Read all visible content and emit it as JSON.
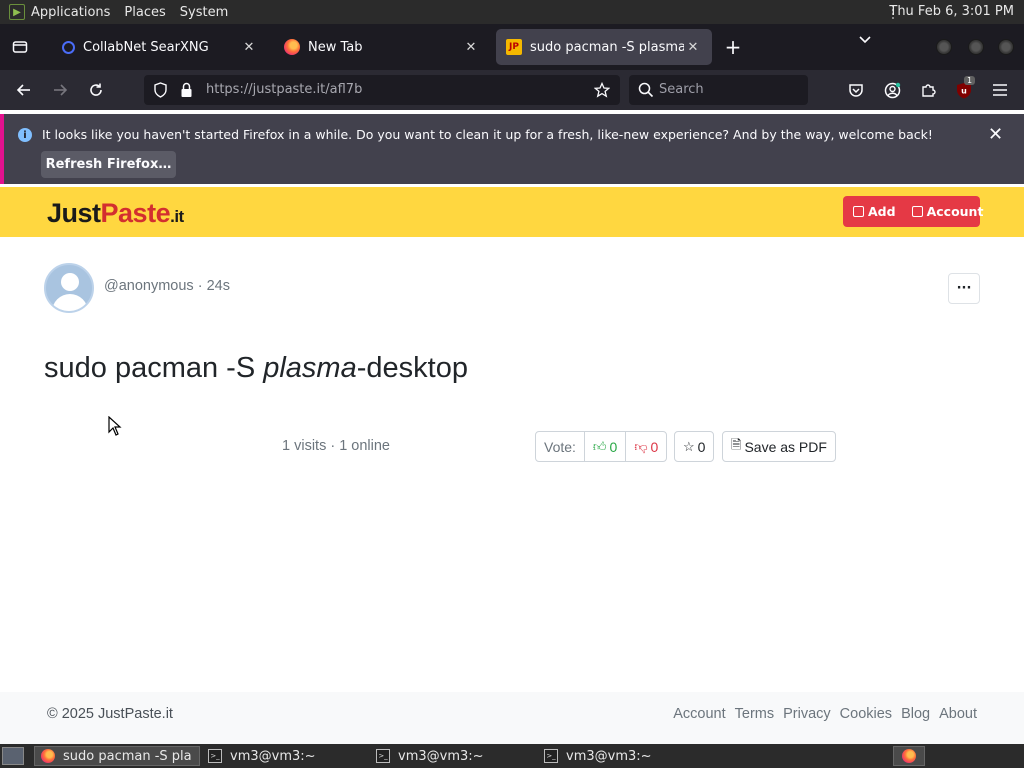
{
  "panel": {
    "menus": [
      "Applications",
      "Places",
      "System"
    ],
    "clock": "Thu Feb  6,  3:01 PM"
  },
  "tabs": [
    {
      "title": "CollabNet SearXNG",
      "icon": "search-icon",
      "selected": false
    },
    {
      "title": "New Tab",
      "icon": "firefox-icon",
      "selected": false
    },
    {
      "title": "sudo pacman -S plasma-desktop",
      "icon": "justpaste-icon",
      "selected": true,
      "visible_title": "sudo pacman -S plasma-de"
    }
  ],
  "navbar": {
    "url_host": "https://justpaste.it/",
    "url_path": "afl7b",
    "search_placeholder": "Search",
    "extension_badge": "1"
  },
  "notification": {
    "message": "It looks like you haven't started Firefox in a while. Do you want to clean it up for a fresh, like-new experience? And by the way, welcome back!",
    "button": "Refresh Firefox…"
  },
  "site": {
    "logo_just": "Just",
    "logo_paste": "Paste",
    "logo_it": ".it",
    "add_label": "Add",
    "account_label": "Account",
    "header_color": "#ffd740",
    "accent_color": "#e53945"
  },
  "paste": {
    "author": "@anonymous",
    "age": "24s",
    "title_before": "sudo pacman -S ",
    "title_italic": "plasma",
    "title_after": "-desktop",
    "stats": "1 visits · 1 online",
    "vote_label": "Vote:",
    "upvotes": "0",
    "downvotes": "0",
    "favorites": "0",
    "save_pdf": "Save as PDF"
  },
  "footer": {
    "copyright": "© 2025 JustPaste.it",
    "links": [
      "Account",
      "Terms",
      "Privacy",
      "Cookies",
      "Blog",
      "About"
    ]
  },
  "taskbar": {
    "tasks": [
      {
        "title": "sudo pacman -S pla...",
        "active": true
      },
      {
        "title": "vm3@vm3:~",
        "active": false
      },
      {
        "title": "vm3@vm3:~",
        "active": false
      },
      {
        "title": "vm3@vm3:~",
        "active": false
      }
    ]
  }
}
